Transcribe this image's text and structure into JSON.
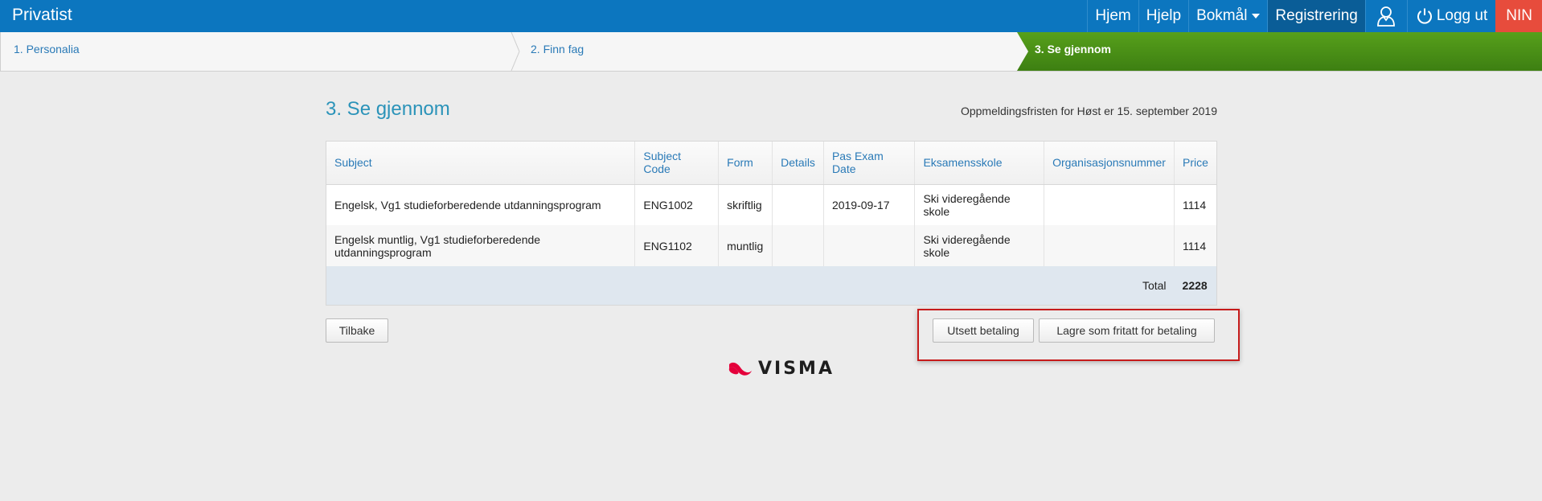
{
  "navbar": {
    "brand": "Privatist",
    "items": {
      "home": "Hjem",
      "help": "Hjelp",
      "language": "Bokmål",
      "registration": "Registrering",
      "logout": "Logg ut",
      "nin": "NIN"
    },
    "colors": {
      "bar": "#0c76bf",
      "active": "#0a5d97",
      "nin": "#e74c3c"
    }
  },
  "steps": {
    "step1": "1. Personalia",
    "step2": "2. Finn fag",
    "step3": "3. Se gjennom",
    "active_color": "#4e9618"
  },
  "main": {
    "title": "3. Se gjennom",
    "deadline": "Oppmeldingsfristen for Høst er 15. september 2019"
  },
  "table": {
    "headers": {
      "subject": "Subject",
      "code": "Subject Code",
      "form": "Form",
      "details": "Details",
      "date": "Pas Exam Date",
      "school": "Eksamensskole",
      "org": "Organisasjonsnummer",
      "price": "Price"
    },
    "rows": [
      {
        "subject": "Engelsk, Vg1 studieforberedende utdanningsprogram",
        "code": "ENG1002",
        "form": "skriftlig",
        "details": "",
        "date": "2019-09-17",
        "school": "Ski videregående skole",
        "org": "",
        "price": "1114"
      },
      {
        "subject": "Engelsk muntlig, Vg1 studieforberedende utdanningsprogram",
        "code": "ENG1102",
        "form": "muntlig",
        "details": "",
        "date": "",
        "school": "Ski videregående skole",
        "org": "",
        "price": "1114"
      }
    ],
    "total_label": "Total",
    "total_value": "2228"
  },
  "buttons": {
    "back": "Tilbake",
    "postpone": "Utsett betaling",
    "exempt": "Lagre som fritatt for betaling"
  },
  "logo": {
    "text": "VISMA",
    "color": "#e4003b"
  }
}
